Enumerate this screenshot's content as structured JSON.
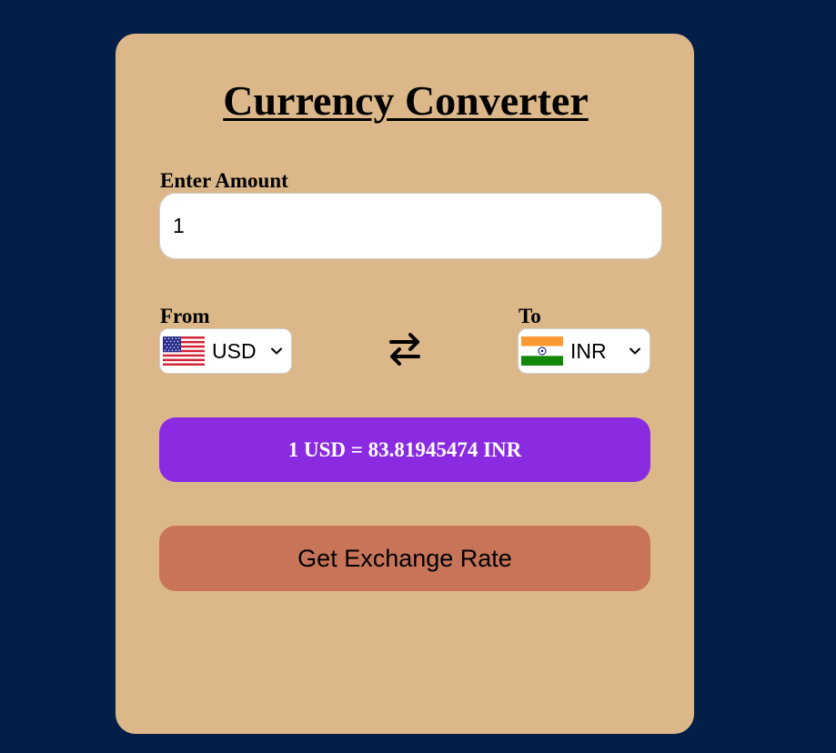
{
  "app": {
    "title": "Currency Converter"
  },
  "amount": {
    "label": "Enter Amount",
    "value": "1"
  },
  "from": {
    "label": "From",
    "currency": "USD",
    "flag_icon": "us-flag-icon"
  },
  "to": {
    "label": "To",
    "currency": "INR",
    "flag_icon": "india-flag-icon"
  },
  "swap": {
    "icon": "swap-arrows-icon"
  },
  "result": {
    "text": "1 USD = 83.81945474 INR"
  },
  "button": {
    "label": "Get Exchange Rate"
  },
  "colors": {
    "page_background": "#031e47",
    "card_background": "#dbb789",
    "result_background": "#8a2be2",
    "button_background": "#c77459"
  }
}
